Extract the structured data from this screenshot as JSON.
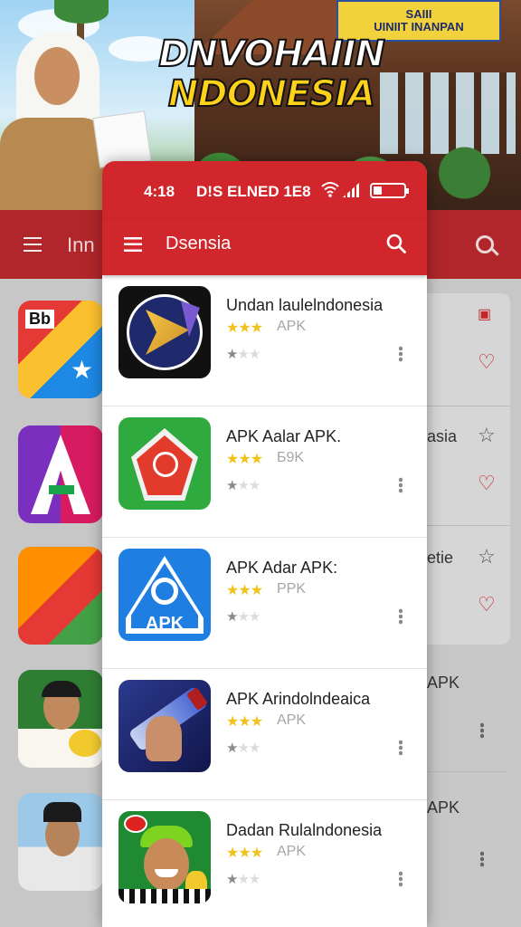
{
  "banner": {
    "title_line1": "DNVOHAIIN",
    "title_line2": "NDONESIA",
    "sign_line1": "SAIII",
    "sign_line2": "UINIIT INANPAN"
  },
  "background_app": {
    "title": "Inn",
    "right_texts": [
      "asia",
      "etie",
      "APK",
      "APK"
    ]
  },
  "status_bar": {
    "time": "4:18",
    "network": "D!S ELNED 1E8"
  },
  "app_bar": {
    "title": "Dsensia"
  },
  "apps": [
    {
      "name": "Undan laulelndonesia",
      "stars": "★★★",
      "tag": "APK",
      "rating": 1,
      "icon": "play-arrow-icon"
    },
    {
      "name": "APK Aalar APK.",
      "stars": "★★★",
      "tag": "Б9K",
      "rating": 1,
      "icon": "shield-fire-icon"
    },
    {
      "name": "APK Adar APK:",
      "stars": "★★★",
      "tag": "PPK",
      "rating": 1,
      "icon": "apk-warning-icon"
    },
    {
      "name": "APK Arindolndeaica",
      "stars": "★★★",
      "tag": "APK",
      "rating": 1,
      "icon": "bottle-photo-icon"
    },
    {
      "name": "Dadan Rulalndonesia",
      "stars": "★★★",
      "tag": "APK",
      "rating": 1,
      "icon": "person-photo-icon"
    }
  ],
  "colors": {
    "primary_red": "#d1262b",
    "star_yellow": "#f1c21b"
  }
}
